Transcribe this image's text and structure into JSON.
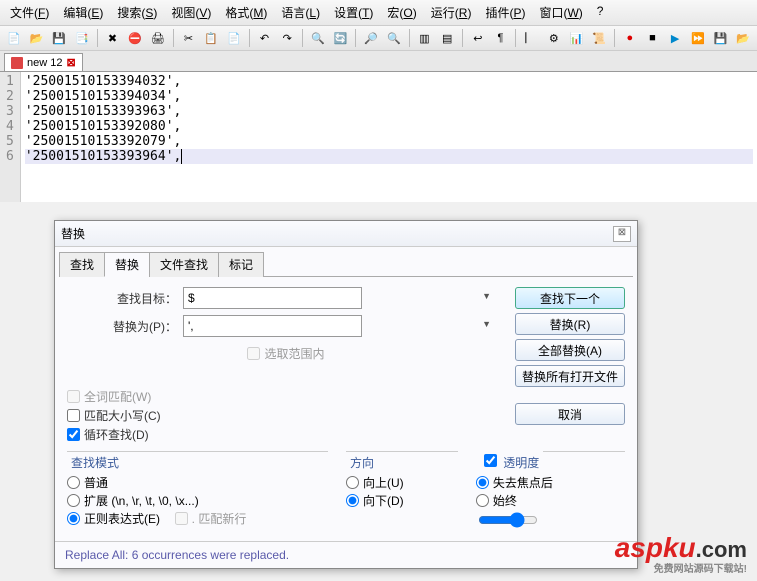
{
  "menu": [
    "文件(F)",
    "编辑(E)",
    "搜索(S)",
    "视图(V)",
    "格式(M)",
    "语言(L)",
    "设置(T)",
    "宏(O)",
    "运行(R)",
    "插件(P)",
    "窗口(W)",
    "?"
  ],
  "tab": {
    "name": "new 12"
  },
  "code": {
    "lines": [
      "'25001510153394032',",
      "'25001510153394034',",
      "'25001510153393963',",
      "'25001510153392080',",
      "'25001510153392079',",
      "'25001510153393964',"
    ]
  },
  "dlg": {
    "title": "替换",
    "tabs": [
      "查找",
      "替换",
      "文件查找",
      "标记"
    ],
    "find_label": "查找目标：",
    "replace_label": "替换为(P)：",
    "find_value": "$",
    "replace_value": "',",
    "chk_inselection": "选取范围内",
    "chk_wholeword": "全词匹配(W)",
    "chk_matchcase": "匹配大小写(C)",
    "chk_wrap": "循环查找(D)",
    "chk_dotnew": ". 匹配新行",
    "grp_mode": "查找模式",
    "mode_normal": "普通",
    "mode_ext": "扩展 (\\n, \\r, \\t, \\0, \\x...)",
    "mode_regex": "正则表达式(E)",
    "grp_dir": "方向",
    "dir_up": "向上(U)",
    "dir_down": "向下(D)",
    "grp_trans": "透明度",
    "trans_onlose": "失去焦点后",
    "trans_always": "始终",
    "btn_findnext": "查找下一个",
    "btn_replace": "替换(R)",
    "btn_replaceall": "全部替换(A)",
    "btn_replaceallopen": "替换所有打开文件",
    "btn_cancel": "取消",
    "status": "Replace All: 6 occurrences were replaced."
  },
  "logo": {
    "brand": "aspku",
    "tld": ".com",
    "sub": "免费网站源码下载站!"
  }
}
